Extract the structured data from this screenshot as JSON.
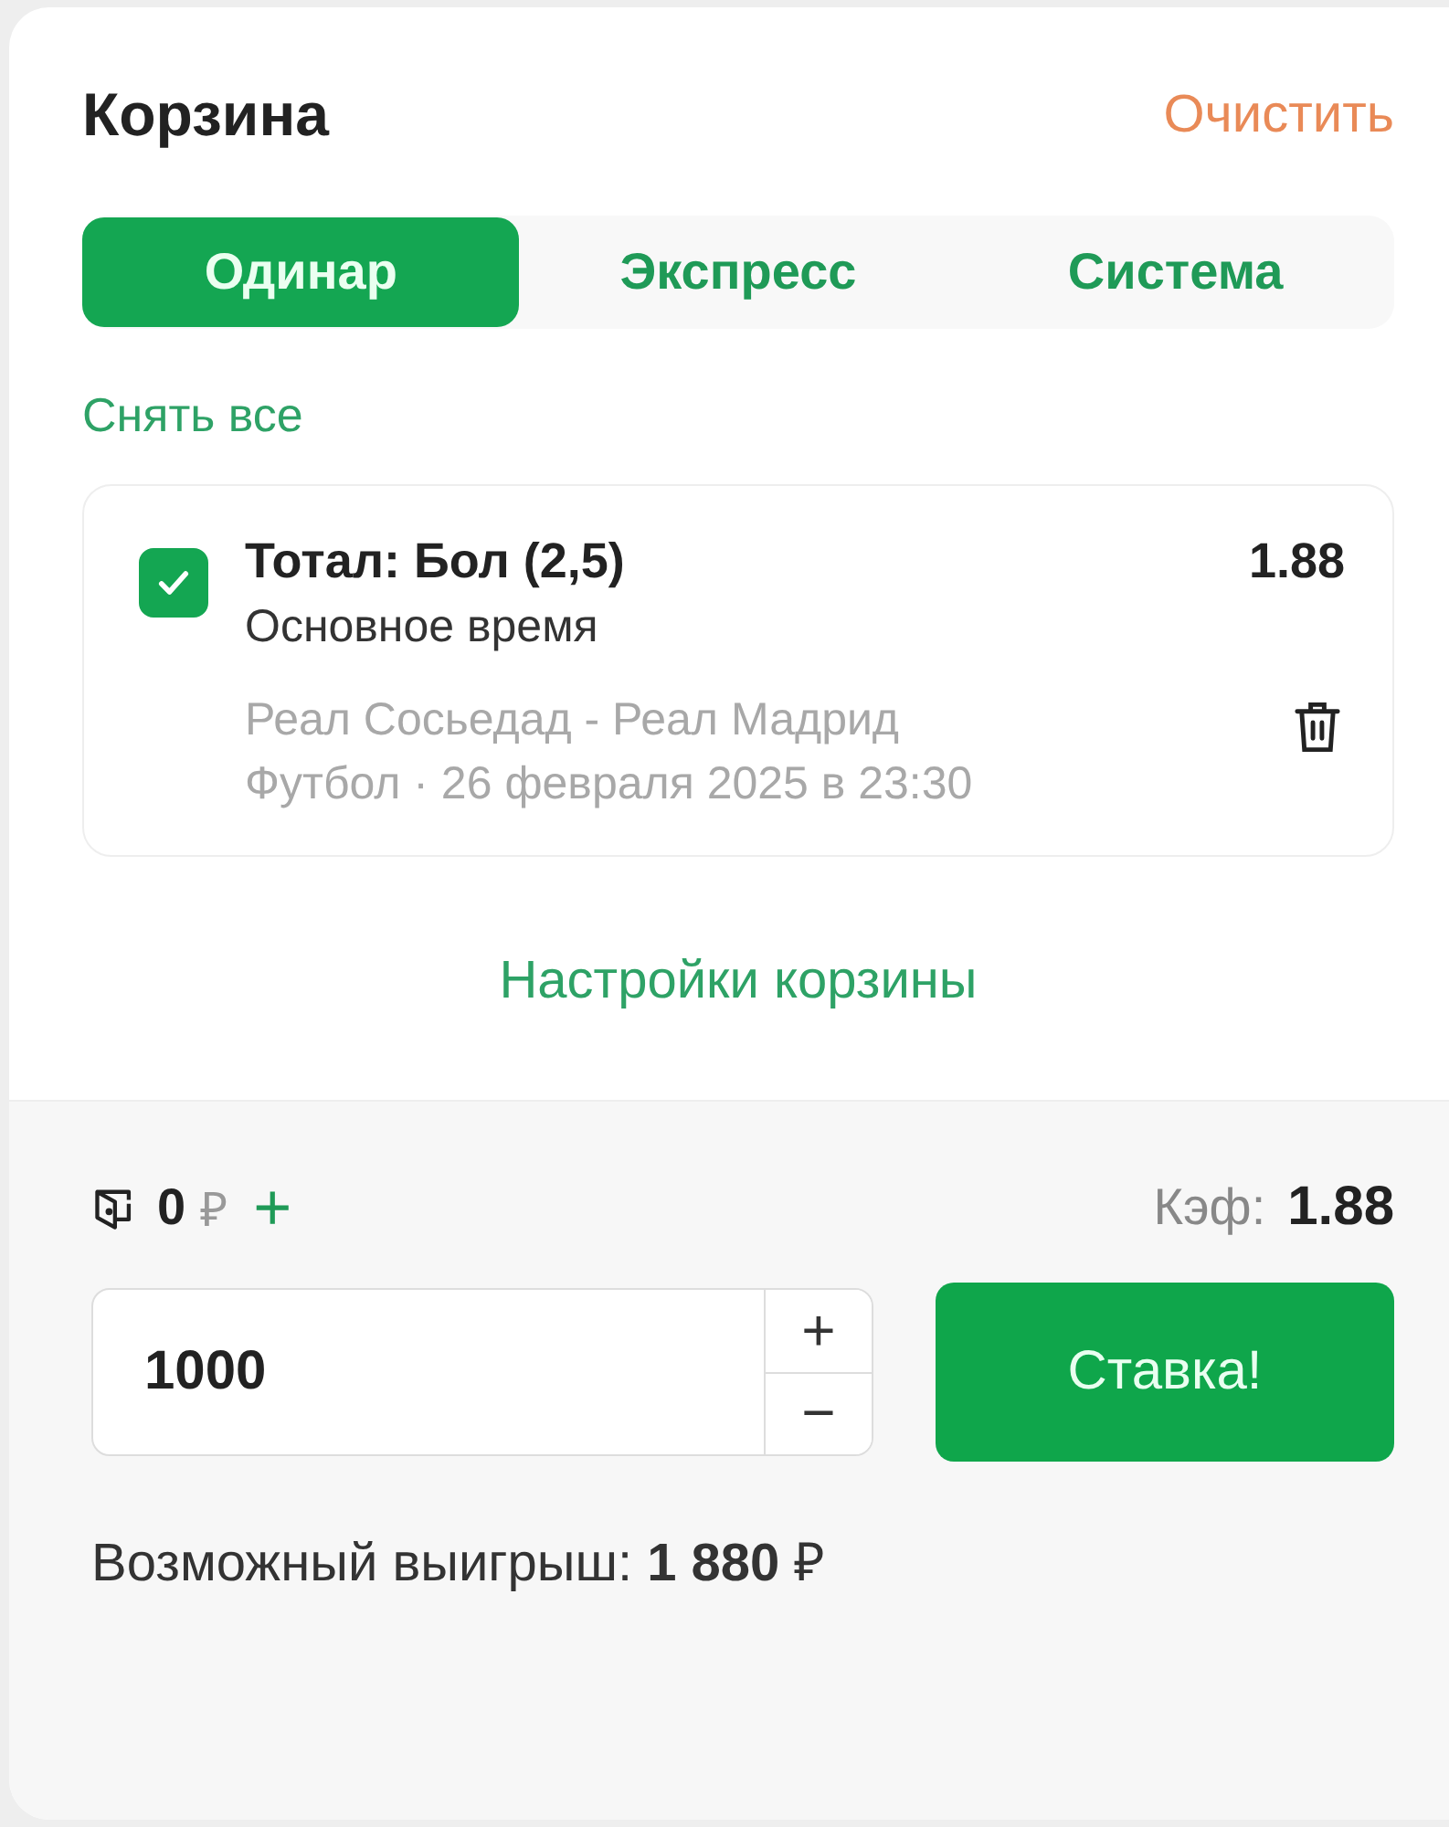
{
  "header": {
    "title": "Корзина",
    "clear_link": "Очистить"
  },
  "tabs": [
    {
      "label": "Одинар",
      "selected": true
    },
    {
      "label": "Экспресс",
      "selected": false
    },
    {
      "label": "Система",
      "selected": false
    }
  ],
  "deselect_all": "Снять все",
  "bets": [
    {
      "checked": true,
      "market": "Тотал: Бол (2,5)",
      "period": "Основное время",
      "odds": "1.88",
      "match": "Реал Сосьедад - Реал Мадрид",
      "details": "Футбол · 26 февраля 2025 в 23:30"
    }
  ],
  "settings_link": "Настройки корзины",
  "balance": {
    "amount": "0",
    "currency": "₽",
    "add": "+"
  },
  "coef": {
    "label": "Кэф:",
    "value": "1.88"
  },
  "stake": {
    "value": "1000",
    "plus": "+",
    "minus": "−"
  },
  "submit": "Ставка!",
  "possible_win": "Возможный выигрыш: **1 880** ₽"
}
